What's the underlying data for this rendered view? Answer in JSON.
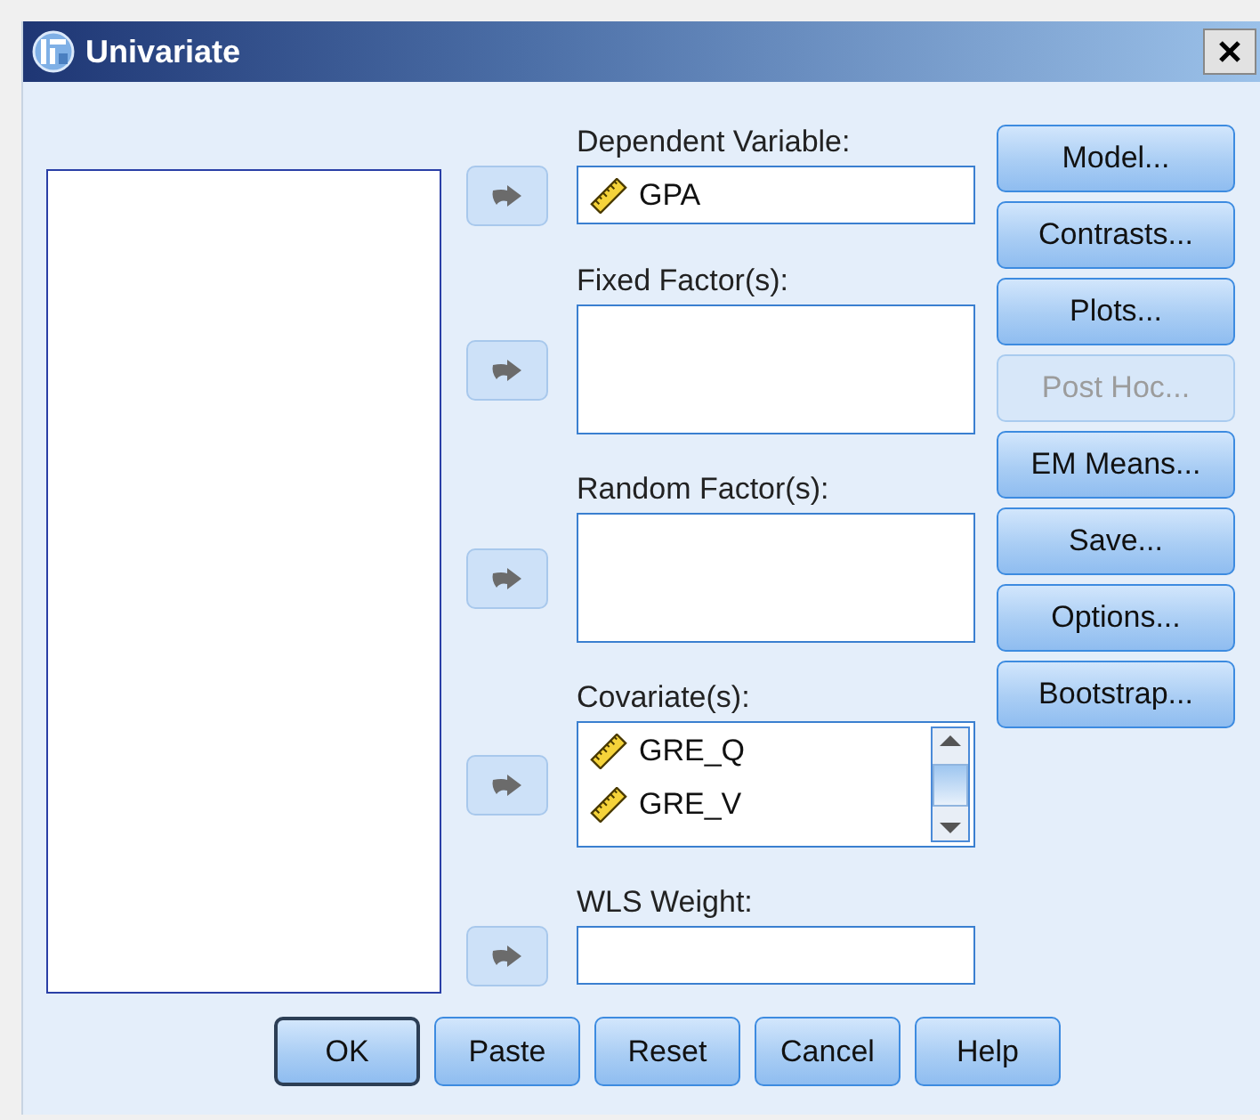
{
  "window": {
    "title": "Univariate"
  },
  "targets": [
    {
      "kind": "single",
      "label": "Dependent Variable:",
      "items": [
        {
          "name": "GPA"
        }
      ]
    },
    {
      "kind": "multi",
      "label": "Fixed Factor(s):"
    },
    {
      "kind": "multi",
      "label": "Random Factor(s):"
    },
    {
      "kind": "scroll",
      "label": "Covariate(s):",
      "items": [
        {
          "name": "GRE_Q"
        },
        {
          "name": "GRE_V"
        }
      ]
    },
    {
      "kind": "single",
      "label": "WLS Weight:"
    }
  ],
  "side_buttons": [
    {
      "label": "Model...",
      "disabled": false
    },
    {
      "label": "Contrasts...",
      "disabled": false
    },
    {
      "label": "Plots...",
      "disabled": false
    },
    {
      "label": "Post Hoc...",
      "disabled": true
    },
    {
      "label": "EM Means...",
      "disabled": false
    },
    {
      "label": "Save...",
      "disabled": false
    },
    {
      "label": "Options...",
      "disabled": false
    },
    {
      "label": "Bootstrap...",
      "disabled": false
    }
  ],
  "footer_buttons": [
    {
      "label": "OK",
      "default": true
    },
    {
      "label": "Paste",
      "default": false
    },
    {
      "label": "Reset",
      "default": false
    },
    {
      "label": "Cancel",
      "default": false
    },
    {
      "label": "Help",
      "default": false
    }
  ]
}
